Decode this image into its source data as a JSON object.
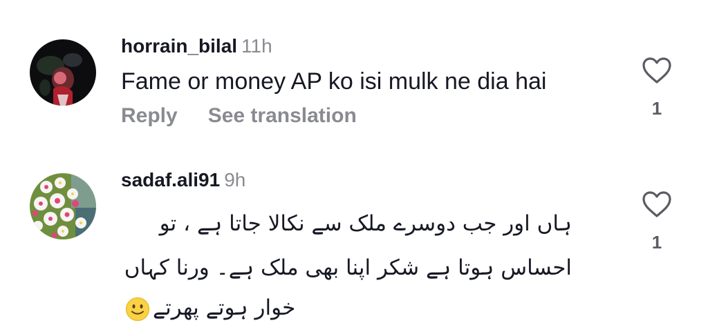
{
  "comments": [
    {
      "username": "horrain_bilal",
      "time": "11h",
      "text": "Fame or money AP ko isi mulk ne dia hai",
      "reply_label": "Reply",
      "translate_label": "See translation",
      "likes": "1",
      "avatar_icon": "user-avatar-dark-photo"
    },
    {
      "username": "sadaf.ali91",
      "time": "9h",
      "lines": [
        "ہاں اور جب دوسرے ملک سے نکالا جاتا ہے ، تو",
        "احساس ہوتا ہے شکر اپنا  بھی  ملک ہے۔  ورنا کہاں",
        "خوار ہوتے پھرتے"
      ],
      "emoji": "slightly-smiling-face-emoji",
      "likes": "1",
      "avatar_icon": "user-avatar-flowers-photo"
    }
  ],
  "colors": {
    "primary_text": "#161823",
    "secondary_text": "#8a8b91",
    "like_count": "#5a5b63"
  }
}
